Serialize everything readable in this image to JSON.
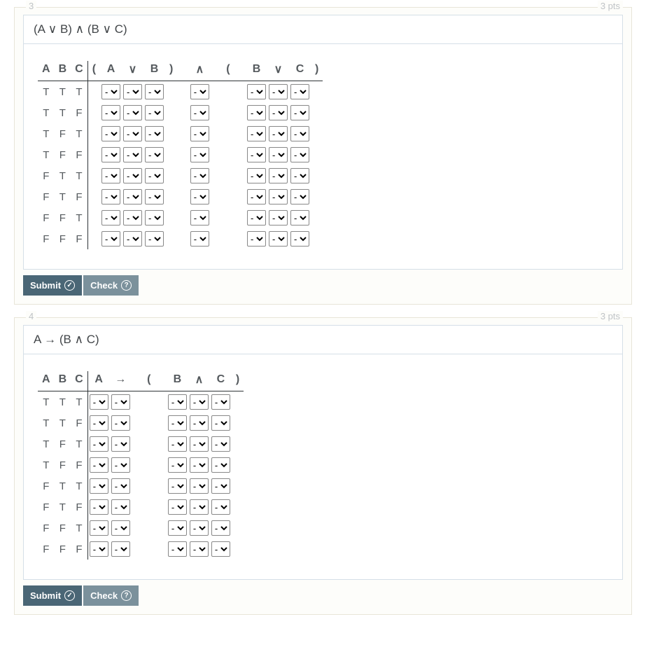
{
  "questions": [
    {
      "number": "3",
      "points": "3 pts",
      "formula": "(A ∨ B) ∧ (B ∨ C)",
      "var_headers": [
        "A",
        "B",
        "C"
      ],
      "expr_tokens": [
        "(",
        "A",
        "∨",
        "B",
        ")",
        "∧",
        "(",
        "B",
        "∨",
        "C",
        ")"
      ],
      "input_cols": [
        1,
        2,
        3,
        5,
        7,
        8,
        9
      ],
      "spacer_after_cols": [
        4,
        5,
        6
      ],
      "rows": [
        [
          "T",
          "T",
          "T"
        ],
        [
          "T",
          "T",
          "F"
        ],
        [
          "T",
          "F",
          "T"
        ],
        [
          "T",
          "F",
          "F"
        ],
        [
          "F",
          "T",
          "T"
        ],
        [
          "F",
          "T",
          "F"
        ],
        [
          "F",
          "F",
          "T"
        ],
        [
          "F",
          "F",
          "F"
        ]
      ],
      "select_default": "-",
      "submit_label": "Submit",
      "check_label": "Check"
    },
    {
      "number": "4",
      "points": "3 pts",
      "formula": "A → (B ∧ C)",
      "var_headers": [
        "A",
        "B",
        "C"
      ],
      "expr_tokens": [
        "A",
        "→",
        "(",
        "B",
        "∧",
        "C",
        ")"
      ],
      "input_cols": [
        0,
        1,
        3,
        4,
        5
      ],
      "spacer_after_cols": [
        1,
        2
      ],
      "rows": [
        [
          "T",
          "T",
          "T"
        ],
        [
          "T",
          "T",
          "F"
        ],
        [
          "T",
          "F",
          "T"
        ],
        [
          "T",
          "F",
          "F"
        ],
        [
          "F",
          "T",
          "T"
        ],
        [
          "F",
          "T",
          "F"
        ],
        [
          "F",
          "F",
          "T"
        ],
        [
          "F",
          "F",
          "F"
        ]
      ],
      "select_default": "-",
      "submit_label": "Submit",
      "check_label": "Check"
    }
  ]
}
